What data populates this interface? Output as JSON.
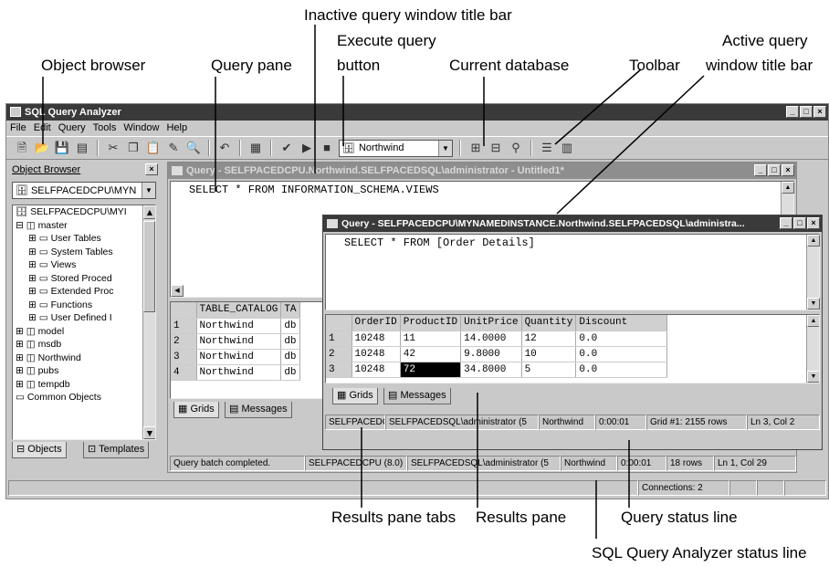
{
  "callouts": {
    "inactive_title": "Inactive query window title bar",
    "execute_1": "Execute query",
    "execute_2": "button",
    "object_browser": "Object browser",
    "query_pane": "Query pane",
    "current_db": "Current database",
    "toolbar": "Toolbar",
    "active_1": "Active query",
    "active_2": "window title bar",
    "results_tabs": "Results pane tabs",
    "results_pane": "Results pane",
    "query_status": "Query status line",
    "app_status": "SQL Query Analyzer status line"
  },
  "app": {
    "title": "SQL Query Analyzer",
    "menu": [
      "File",
      "Edit",
      "Query",
      "Tools",
      "Window",
      "Help"
    ],
    "database": "Northwind"
  },
  "object_browser": {
    "title": "Object Browser",
    "server_combo": "SELFPACEDCPU\\MYN",
    "root": "SELFPACEDCPU\\MYI",
    "master": "master",
    "items": [
      "User Tables",
      "System Tables",
      "Views",
      "Stored Proced",
      "Extended Proc",
      "Functions",
      "User Defined I"
    ],
    "dbs": [
      "model",
      "msdb",
      "Northwind",
      "pubs",
      "tempdb"
    ],
    "common": "Common Objects",
    "tab_objects": "Objects",
    "tab_templates": "Templates"
  },
  "q1": {
    "title": "Query - SELFPACEDCPU.Northwind.SELFPACEDSQL\\administrator - Untitled1*",
    "sql": "SELECT * FROM INFORMATION_SCHEMA.VIEWS",
    "columns": [
      "TABLE_CATALOG",
      "TA"
    ],
    "rows": [
      [
        "1",
        "Northwind",
        "db"
      ],
      [
        "2",
        "Northwind",
        "db"
      ],
      [
        "3",
        "Northwind",
        "db"
      ],
      [
        "4",
        "Northwind",
        "db"
      ]
    ],
    "tab_grids": "Grids",
    "tab_messages": "Messages",
    "status": [
      "Query batch completed.",
      "SELFPACEDCPU (8.0)",
      "SELFPACEDSQL\\administrator (5",
      "Northwind",
      "0:00:01",
      "18 rows",
      "Ln 1, Col 29"
    ]
  },
  "q2": {
    "title": "Query - SELFPACEDCPU\\MYNAMEDINSTANCE.Northwind.SELFPACEDSQL\\administra...",
    "sql": "SELECT * FROM [Order Details]",
    "columns": [
      "OrderID",
      "ProductID",
      "UnitPrice",
      "Quantity",
      "Discount"
    ],
    "rows": [
      [
        "1",
        "10248",
        "11",
        "14.0000",
        "12",
        "0.0"
      ],
      [
        "2",
        "10248",
        "42",
        "9.8000",
        "10",
        "0.0"
      ],
      [
        "3",
        "10248",
        "72",
        "34.8000",
        "5",
        "0.0"
      ]
    ],
    "tab_grids": "Grids",
    "tab_messages": "Messages",
    "status": [
      "SELFPACEDC",
      "SELFPACEDSQL\\administrator (5",
      "Northwind",
      "0:00:01",
      "Grid #1: 2155 rows",
      "Ln 3, Col 2"
    ]
  },
  "app_status": {
    "connections": "Connections: 2"
  }
}
